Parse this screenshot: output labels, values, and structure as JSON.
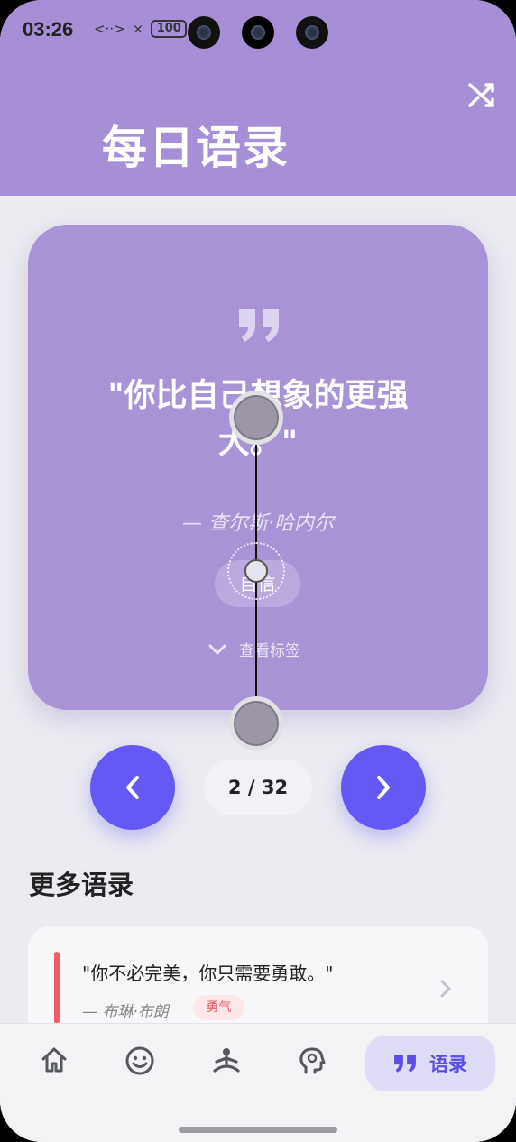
{
  "status_bar": {
    "time": "03:26",
    "battery": "100",
    "net_icon": "<··>",
    "signal": "×"
  },
  "header": {
    "title": "每日语录",
    "shuffle_icon": "shuffle-icon"
  },
  "quote_card": {
    "quote_mark": "❞",
    "text": "\"你比自己想象的更强大。\"",
    "author": "— 查尔斯·哈内尔",
    "tag": "自信",
    "view_tags_label": "查看标签"
  },
  "navigation": {
    "prev": "‹",
    "next": "›",
    "counter": "2 / 32"
  },
  "more": {
    "title": "更多语录",
    "items": [
      {
        "text": "\"你不必完美，你只需要勇敢。\"",
        "author": "— 布琳·布朗",
        "tag": "勇气",
        "arrow": "›"
      }
    ]
  },
  "tabbar": {
    "home_icon": "⌂",
    "mood_icon": "☺",
    "meditation_icon": "⚇",
    "mind_icon": "☼",
    "active_label": "语录",
    "active_icon": "❞"
  },
  "colors": {
    "header": "#a68fd6",
    "card": "#a893d6",
    "accent": "#6558f5",
    "tag_red": "#ef5a68"
  }
}
